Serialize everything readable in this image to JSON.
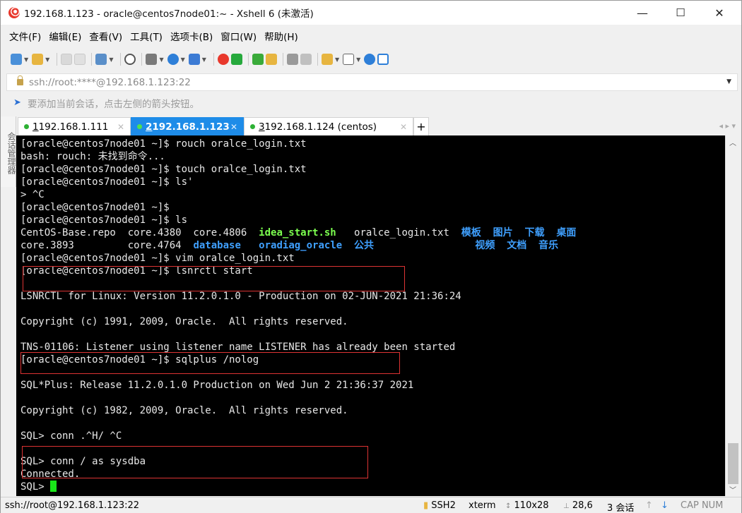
{
  "window": {
    "title": "192.168.1.123 - oracle@centos7node01:~ - Xshell 6 (未激活)",
    "minimize": "—",
    "maximize": "☐",
    "close": "✕"
  },
  "menu": [
    "文件(F)",
    "编辑(E)",
    "查看(V)",
    "工具(T)",
    "选项卡(B)",
    "窗口(W)",
    "帮助(H)"
  ],
  "address": {
    "text": "ssh://root:****@192.168.1.123:22"
  },
  "hint": "要添加当前会话，点击左侧的箭头按钮。",
  "side_panel": "会话管理器",
  "tabs": [
    {
      "num": "1",
      "label": " 192.168.1.111",
      "active": false
    },
    {
      "num": "2",
      "label": " 192.168.1.123",
      "active": true
    },
    {
      "num": "3",
      "label": " 192.168.1.124  (centos)",
      "active": false
    }
  ],
  "tab_add": "+",
  "tab_nav": "◂ ▸ ▾",
  "terminal": {
    "lines": [
      "[oracle@centos7node01 ~]$ rouch oralce_login.txt",
      "bash: rouch: 未找到命令...",
      "[oracle@centos7node01 ~]$ touch oralce_login.txt",
      "[oracle@centos7node01 ~]$ ls'",
      "> ^C",
      "[oracle@centos7node01 ~]$",
      "[oracle@centos7node01 ~]$ ls"
    ],
    "ls_row1": {
      "a": "CentOS-Base.repo  core.4380  core.4806  ",
      "b": "idea_start.sh",
      "c": "   oralce_login.txt  ",
      "d": "模板  图片  下载  桌面"
    },
    "ls_row2": {
      "a": "core.3893         core.4764  ",
      "b": "database",
      "c": "   ",
      "d": "oradiag_oracle",
      "e": "  公共",
      "f": "                 视频  文档  音乐"
    },
    "lines2": [
      "[oracle@centos7node01 ~]$ vim oralce_login.txt",
      "[oracle@centos7node01 ~]$ lsnrctl start",
      "",
      "LSNRCTL for Linux: Version 11.2.0.1.0 - Production on 02-JUN-2021 21:36:24",
      "",
      "Copyright (c) 1991, 2009, Oracle.  All rights reserved.",
      "",
      "TNS-01106: Listener using listener name LISTENER has already been started",
      "[oracle@centos7node01 ~]$ sqlplus /nolog",
      "",
      "SQL*Plus: Release 11.2.0.1.0 Production on Wed Jun 2 21:36:37 2021",
      "",
      "Copyright (c) 1982, 2009, Oracle.  All rights reserved.",
      "",
      "SQL> conn .^H/ ^C",
      "",
      "SQL> conn / as sysdba",
      "Connected.",
      "SQL> "
    ]
  },
  "status": {
    "connection": "ssh://root@192.168.1.123:22",
    "proto": "SSH2",
    "term": "xterm",
    "size": "110x28",
    "pos": "28,6",
    "sessions": "3 会话",
    "caps": "CAP NUM"
  },
  "colors": {
    "accent": "#1e8ce8",
    "terminal_bg": "#000000",
    "executable": "#7cff4f",
    "directory": "#3fa0ff",
    "highlight_box": "#dd3333"
  }
}
